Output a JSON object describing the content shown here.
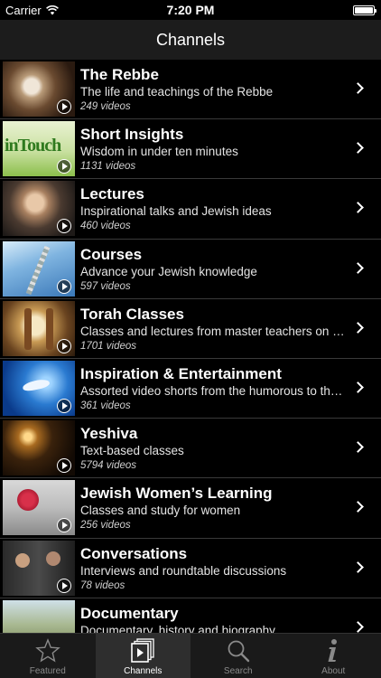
{
  "status_bar": {
    "carrier": "Carrier",
    "time": "7:20 PM"
  },
  "nav": {
    "title": "Channels"
  },
  "channels": [
    {
      "title": "The Rebbe",
      "subtitle": "The life and teachings of the Rebbe",
      "count": "249 videos"
    },
    {
      "title": "Short Insights",
      "subtitle": "Wisdom in under ten minutes",
      "count": "1131 videos",
      "thumb_text": "inTouch"
    },
    {
      "title": "Lectures",
      "subtitle": "Inspirational talks and Jewish ideas",
      "count": "460 videos"
    },
    {
      "title": "Courses",
      "subtitle": "Advance your Jewish knowledge",
      "count": "597 videos"
    },
    {
      "title": "Torah Classes",
      "subtitle": "Classes and lectures from master teachers on a var...",
      "count": "1701 videos"
    },
    {
      "title": "Inspiration & Entertainment",
      "subtitle": "Assorted video shorts from the humorous to the poi...",
      "count": "361 videos"
    },
    {
      "title": "Yeshiva",
      "subtitle": "Text-based classes",
      "count": "5794 videos"
    },
    {
      "title": "Jewish Women’s Learning",
      "subtitle": "Classes and study for women",
      "count": "256 videos"
    },
    {
      "title": "Conversations",
      "subtitle": "Interviews and roundtable discussions",
      "count": "78 videos"
    },
    {
      "title": "Documentary",
      "subtitle": "Documentary, history and biography",
      "count": ""
    }
  ],
  "tabs": [
    {
      "label": "Featured",
      "icon": "star-icon"
    },
    {
      "label": "Channels",
      "icon": "channels-icon"
    },
    {
      "label": "Search",
      "icon": "search-icon"
    },
    {
      "label": "About",
      "icon": "info-icon"
    }
  ],
  "colors": {
    "background": "#000000",
    "nav_bar": "#1c1c1c",
    "tab_bar": "#1a1a1a",
    "tab_active": "#2e2e2e",
    "tab_inactive_text": "#8a8a8a"
  }
}
